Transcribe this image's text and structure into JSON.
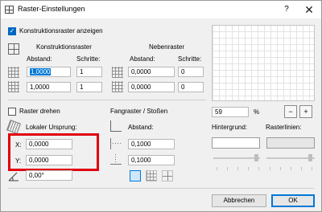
{
  "window": {
    "title": "Raster-Einstellungen",
    "help": "?",
    "close": "✕"
  },
  "show_grid": {
    "label": "Konstruktionsraster anzeigen",
    "checked": true
  },
  "construction_grid": {
    "heading": "Konstruktionsraster",
    "spacing_label": "Abstand:",
    "steps_label": "Schritte:",
    "x_spacing": "1,0000",
    "x_steps": "1",
    "y_spacing": "1,0000",
    "y_steps": "1"
  },
  "secondary_grid": {
    "heading": "Nebenraster",
    "spacing_label": "Abstand:",
    "steps_label": "Schritte:",
    "x_spacing": "0,0000",
    "x_steps": "0",
    "y_spacing": "0,0000",
    "y_steps": "0"
  },
  "rotate_grid": {
    "label": "Raster drehen",
    "checked": false
  },
  "local_origin": {
    "label": "Lokaler Ursprung:",
    "x_label": "X:",
    "x_value": "0,0000",
    "y_label": "Y:",
    "y_value": "0,0000",
    "angle_value": "0,00°"
  },
  "snap_grid": {
    "heading": "Fangraster / Stoßen",
    "spacing_label": "Abstand:",
    "x_spacing": "0,1000",
    "y_spacing": "0,1000"
  },
  "zoom": {
    "value": "59",
    "unit": "%"
  },
  "colors": {
    "background_label": "Hintergrund:",
    "gridlines_label": "Rasterlinien:",
    "background_swatch": "#ffffff",
    "gridlines_swatch": "#e6e6e6",
    "highlight": "#e0000f"
  },
  "buttons": {
    "cancel": "Abbrechen",
    "ok": "OK"
  }
}
